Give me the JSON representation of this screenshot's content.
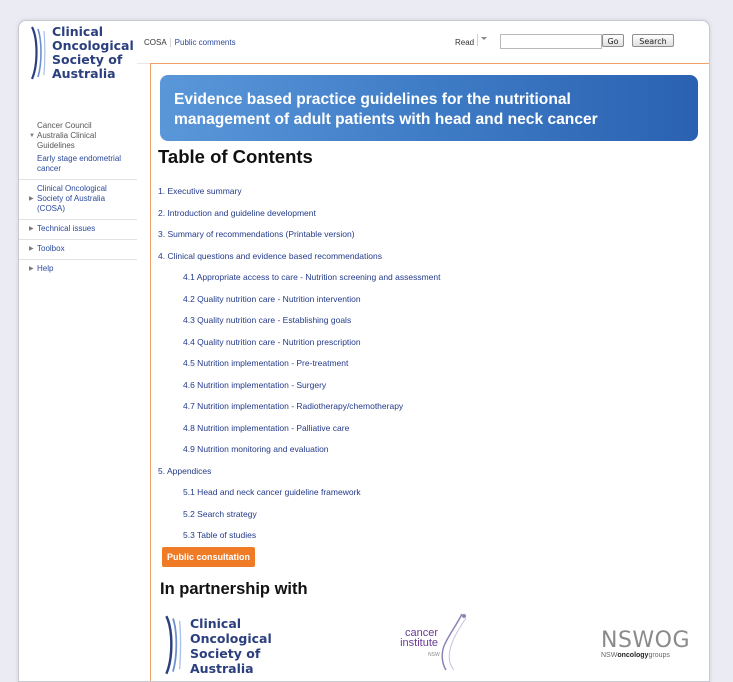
{
  "sidebar": {
    "logo_lines": [
      "Clinical",
      "Oncological",
      "Society of",
      "Australia"
    ],
    "nav": [
      {
        "label": "Cancer Council Australia Clinical Guidelines",
        "expanded": true
      },
      {
        "label": "Early stage endometrial cancer"
      },
      {
        "label": "Clinical Oncological Society of Australia (COSA)"
      },
      {
        "label": "Technical issues"
      },
      {
        "label": "Toolbox"
      },
      {
        "label": "Help"
      }
    ]
  },
  "toolbar": {
    "crumbs": [
      "COSA",
      "Public comments"
    ],
    "read_label": "Read",
    "search_value": "",
    "go_label": "Go",
    "search_label": "Search"
  },
  "main": {
    "banner_lines": [
      "Evidence based practice guidelines for the nutritional",
      "management of adult patients with head and neck cancer"
    ],
    "toc_title": "Table of Contents",
    "toc": [
      "1. Executive summary",
      "2. Introduction and guideline development",
      "3. Summary of recommendations (Printable version)",
      "4. Clinical questions and evidence based recommendations",
      "4.1 Appropriate access to care - Nutrition screening and assessment",
      "4.2 Quality nutrition care - Nutrition intervention",
      "4.3 Quality nutrition care - Establishing goals",
      "4.4 Quality nutrition care - Nutrition prescription",
      "4.5 Nutrition implementation - Pre-treatment",
      "4.6 Nutrition implementation - Surgery",
      "4.7 Nutrition implementation - Radiotherapy/chemotherapy",
      "4.8 Nutrition implementation - Palliative care",
      "4.9 Nutrition monitoring and evaluation",
      "5. Appendices",
      "5.1 Head and neck cancer guideline framework",
      "5.2 Search strategy",
      "5.3 Table of studies"
    ],
    "consult_label": "Public consultation",
    "partner_heading": "In partnership with",
    "cosa_logo_lines": [
      "Clinical",
      "Oncological",
      "Society of",
      "Australia"
    ],
    "ci_logo_lines": [
      "cancer",
      "institute"
    ],
    "ci_small": "NSW",
    "nswog_big": "NSWOG",
    "nswog_prefix": "NSW",
    "nswog_bold": "oncology",
    "nswog_suffix": "groups"
  },
  "colors": {
    "brand": "#2b3f7e",
    "link": "#233a8a",
    "accent": "#f07b26",
    "banner": "#3f7cc6"
  }
}
